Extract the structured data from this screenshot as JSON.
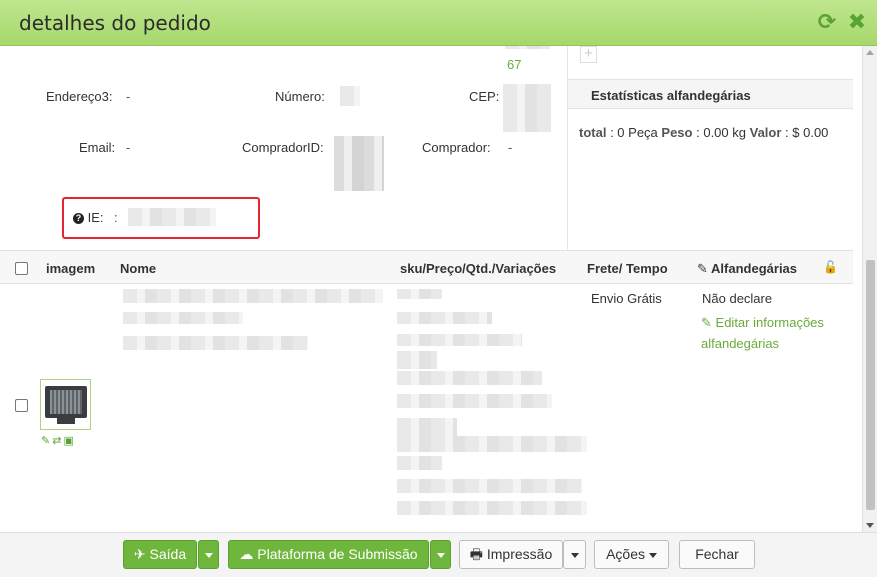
{
  "window": {
    "title": "detalhes do pedido",
    "refresh_icon": "refresh-icon",
    "close_icon": "close-icon"
  },
  "address": {
    "top_value_partial": "67",
    "endereco3_label": "Endereço3:",
    "endereco3_value": "-",
    "numero_label": "Número:",
    "cep_label": "CEP:",
    "email_label": "Email:",
    "email_value": "-",
    "comprador_id_label": "CompradorID:",
    "comprador_label": "Comprador:",
    "comprador_value": "-",
    "ie_label": "IE:",
    "ie_sep": ":"
  },
  "stats": {
    "title": "Estatísticas alfandegárias",
    "total_label": "total",
    "total_value": ": 0 Peça",
    "peso_label": "Peso",
    "peso_value": ": 0.00 kg",
    "valor_label": "Valor",
    "valor_value": ": $ 0.00"
  },
  "table": {
    "headers": {
      "imagem": "imagem",
      "nome": "Nome",
      "sku": "sku/Preço/Qtd./Variações",
      "frete": "Frete/ Tempo",
      "alfandegarias": "Alfandegárias"
    },
    "row": {
      "frete": "Envio Grátis",
      "customs_status": "Não declare",
      "edit_customs_line1": "Editar informações",
      "edit_customs_line2": "alfandegárias"
    }
  },
  "footer": {
    "saida": "Saída",
    "plataforma": "Plataforma de Submissão",
    "impressao": "Impressão",
    "acoes": "Ações",
    "fechar": "Fechar"
  },
  "colors": {
    "title_bar": "#a6d86c",
    "accent_green": "#6fb63d",
    "link_green": "#6aaa3a",
    "highlight_red": "#e5262d"
  }
}
